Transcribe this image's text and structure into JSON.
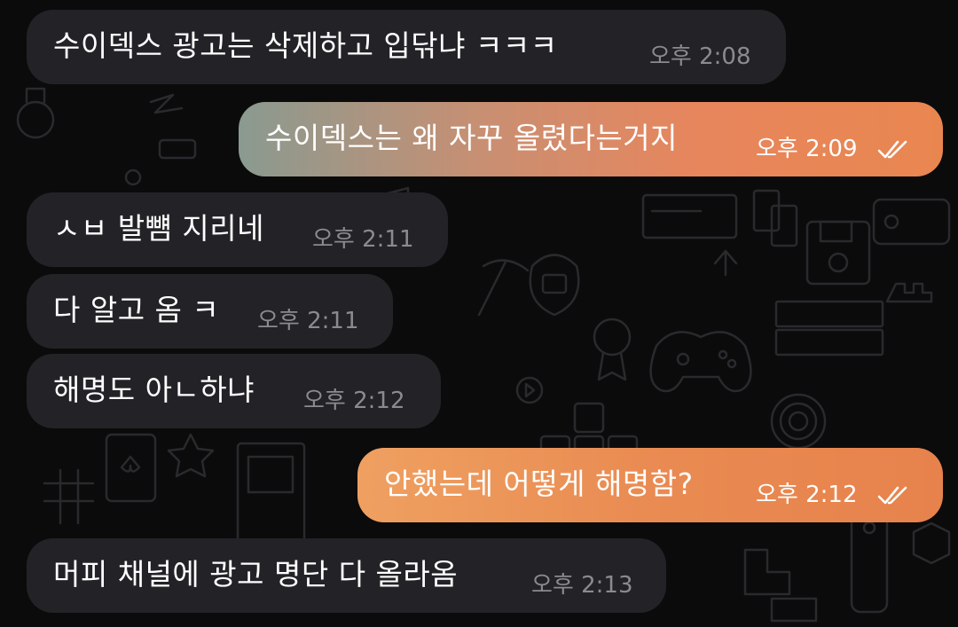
{
  "colors": {
    "background": "#0b0b0c",
    "incoming_bubble": "#232327",
    "outgoing_accent": "#e98650",
    "time_incoming": "#8a8a90"
  },
  "status_icon": "double-check-icon",
  "messages": [
    {
      "text": "수이덱스 광고는 삭제하고 입닦냐 ㅋㅋㅋ",
      "time": "오후 2:08",
      "direction": "incoming"
    },
    {
      "text": "수이덱스는 왜 자꾸 올렸다는거지",
      "time": "오후 2:09",
      "direction": "outgoing",
      "read": true
    },
    {
      "text": "ㅅㅂ 발뻄 지리네",
      "time": "오후 2:11",
      "direction": "incoming"
    },
    {
      "text": "다 알고 옴 ㅋ",
      "time": "오후 2:11",
      "direction": "incoming"
    },
    {
      "text": "해명도 아ㄴ하냐",
      "time": "오후 2:12",
      "direction": "incoming"
    },
    {
      "text": "안했는데 어떻게 해명함?",
      "time": "오후 2:12",
      "direction": "outgoing",
      "read": true
    },
    {
      "text": "머피 채널에 광고 명단 다 올라옴",
      "time": "오후 2:13",
      "direction": "incoming"
    }
  ]
}
